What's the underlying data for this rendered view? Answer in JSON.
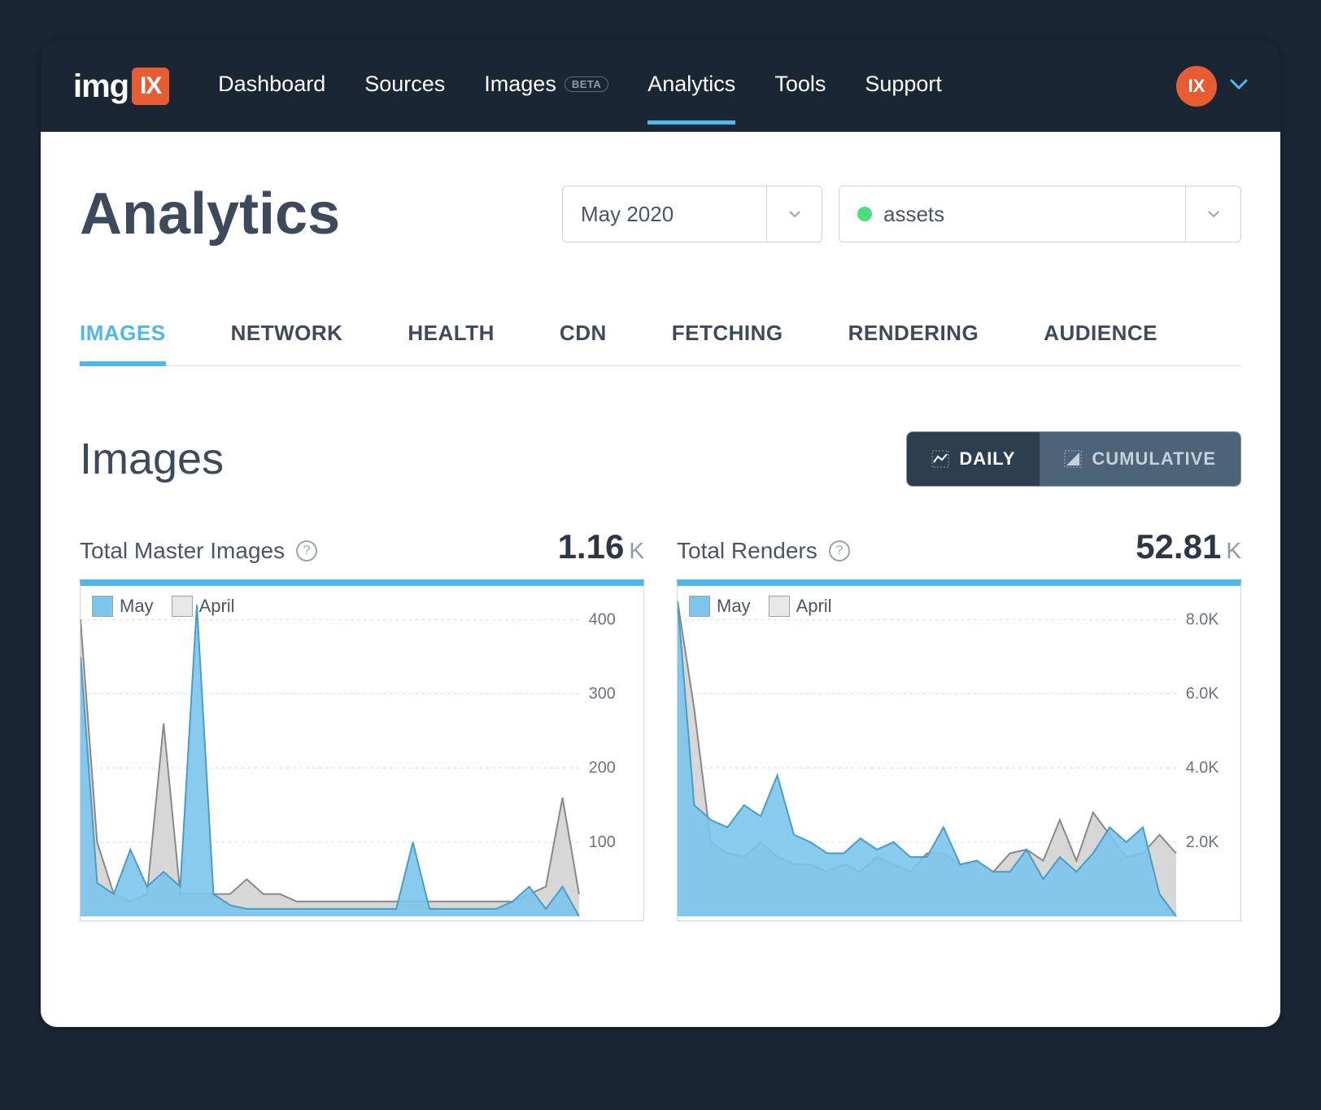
{
  "brand": {
    "prefix": "img",
    "box": "IX"
  },
  "nav": {
    "items": [
      {
        "label": "Dashboard"
      },
      {
        "label": "Sources"
      },
      {
        "label": "Images",
        "beta": "BETA"
      },
      {
        "label": "Analytics",
        "active": true
      },
      {
        "label": "Tools"
      },
      {
        "label": "Support"
      }
    ]
  },
  "avatar": {
    "text": "IX"
  },
  "page": {
    "title": "Analytics"
  },
  "filters": {
    "date": "May 2020",
    "source": "assets"
  },
  "tabs": [
    "IMAGES",
    "NETWORK",
    "HEALTH",
    "CDN",
    "FETCHING",
    "RENDERING",
    "AUDIENCE"
  ],
  "section": {
    "title": "Images"
  },
  "toggle": {
    "daily": "DAILY",
    "cumulative": "CUMULATIVE"
  },
  "charts": [
    {
      "label": "Total Master Images",
      "value": "1.16",
      "unit": "K",
      "legend": {
        "current": "May",
        "previous": "April"
      },
      "yticks": [
        "100",
        "200",
        "300",
        "400"
      ]
    },
    {
      "label": "Total Renders",
      "value": "52.81",
      "unit": "K",
      "legend": {
        "current": "May",
        "previous": "April"
      },
      "yticks": [
        "2.0K",
        "4.0K",
        "6.0K",
        "8.0K"
      ]
    }
  ],
  "chart_data": [
    {
      "type": "area",
      "title": "Total Master Images",
      "xlabel": "",
      "ylabel": "",
      "ylim": [
        0,
        440
      ],
      "x_days": 31,
      "series": [
        {
          "name": "May",
          "values": [
            350,
            45,
            30,
            90,
            40,
            60,
            40,
            420,
            30,
            15,
            10,
            10,
            10,
            10,
            10,
            10,
            10,
            10,
            10,
            10,
            100,
            10,
            10,
            10,
            10,
            10,
            20,
            40,
            10,
            40,
            0
          ]
        },
        {
          "name": "April",
          "values": [
            400,
            100,
            30,
            20,
            30,
            260,
            30,
            30,
            30,
            30,
            50,
            30,
            30,
            20,
            20,
            20,
            20,
            20,
            20,
            20,
            20,
            20,
            20,
            20,
            20,
            20,
            20,
            30,
            40,
            160,
            30
          ]
        }
      ]
    },
    {
      "type": "area",
      "title": "Total Renders",
      "xlabel": "",
      "ylabel": "",
      "ylim": [
        0,
        8800
      ],
      "x_days": 31,
      "series": [
        {
          "name": "May",
          "values": [
            8500,
            3000,
            2600,
            2400,
            3000,
            2700,
            3800,
            2200,
            2000,
            1700,
            1700,
            2100,
            1800,
            2000,
            1600,
            1600,
            2400,
            1400,
            1500,
            1200,
            1200,
            1800,
            1000,
            1600,
            1200,
            1700,
            2400,
            2000,
            2400,
            600,
            0
          ]
        },
        {
          "name": "April",
          "values": [
            8500,
            5600,
            2000,
            1700,
            1600,
            2000,
            1600,
            1400,
            1400,
            1200,
            1400,
            1200,
            1600,
            1400,
            1200,
            1700,
            1700,
            1400,
            1500,
            1200,
            1700,
            1800,
            1500,
            2600,
            1500,
            2800,
            2200,
            1600,
            1700,
            2200,
            1700
          ]
        }
      ]
    }
  ]
}
